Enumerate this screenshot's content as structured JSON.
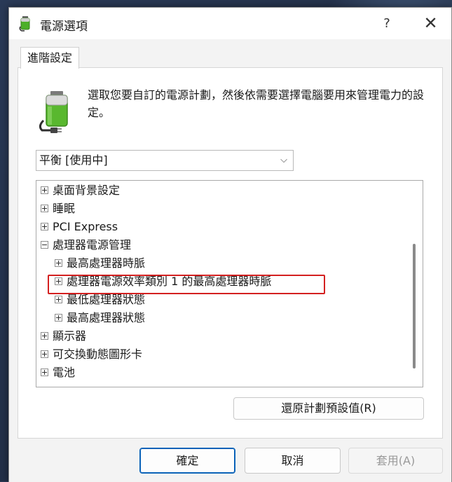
{
  "window": {
    "title": "電源選項",
    "help_label": "?",
    "close_label": "✕"
  },
  "tab": {
    "label": "進階設定"
  },
  "description": "選取您要自訂的電源計劃，然後依需要選擇電腦要用來管理電力的設定。",
  "plan_select": {
    "value": "平衡 [使用中]",
    "chevron": "⌵"
  },
  "tree": {
    "items": [
      {
        "label": "桌面背景設定",
        "level": 0,
        "expanded": false
      },
      {
        "label": "睡眠",
        "level": 0,
        "expanded": false
      },
      {
        "label": "PCI Express",
        "level": 0,
        "expanded": false
      },
      {
        "label": "處理器電源管理",
        "level": 0,
        "expanded": true
      },
      {
        "label": "最高處理器時脈",
        "level": 1,
        "expanded": false
      },
      {
        "label": "處理器電源效率類別 1 的最高處理器時脈",
        "level": 1,
        "expanded": false
      },
      {
        "label": "最低處理器狀態",
        "level": 1,
        "expanded": false
      },
      {
        "label": "最高處理器狀態",
        "level": 1,
        "expanded": false
      },
      {
        "label": "顯示器",
        "level": 0,
        "expanded": false
      },
      {
        "label": "可交換動態圖形卡",
        "level": 0,
        "expanded": false
      },
      {
        "label": "電池",
        "level": 0,
        "expanded": false
      }
    ]
  },
  "buttons": {
    "restore": "還原計劃預設值(R)",
    "ok": "確定",
    "cancel": "取消",
    "apply": "套用(A)"
  },
  "colors": {
    "highlight": "#d42020",
    "accent": "#0a62b8",
    "battery_green": "#4caf28"
  }
}
